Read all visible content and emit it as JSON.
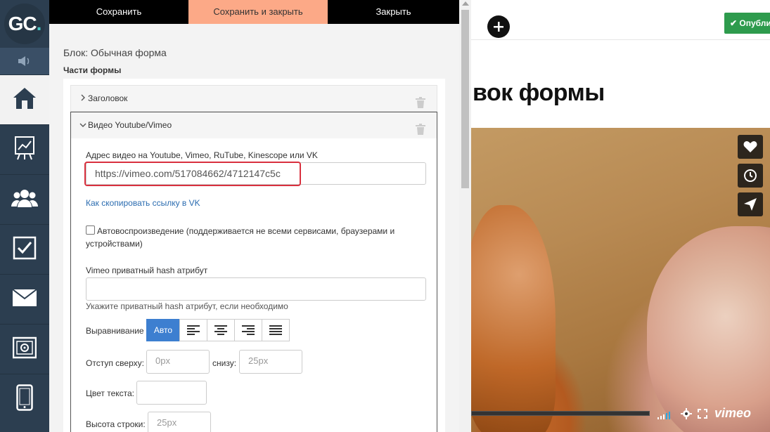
{
  "sidebar": {
    "logo_text": "GC",
    "logo_dot": ".",
    "items": [
      {
        "name": "home-icon",
        "active": true
      },
      {
        "name": "chart-icon",
        "active": false
      },
      {
        "name": "users-icon",
        "active": false
      },
      {
        "name": "checkbox-icon",
        "active": false
      },
      {
        "name": "mail-icon",
        "active": false
      },
      {
        "name": "safe-icon",
        "active": false
      },
      {
        "name": "phone-icon",
        "active": false
      }
    ]
  },
  "toolbar": {
    "save_label": "Сохранить",
    "save_close_label": "Сохранить и закрыть",
    "close_label": "Закрыть"
  },
  "editor": {
    "block_title": "Блок: Обычная форма",
    "parts_title": "Части формы",
    "accordion": {
      "header_label": "Заголовок",
      "video_label": "Видео Youtube/Vimeo"
    },
    "video": {
      "url_label": "Адрес видео на Youtube, Vimeo, RuTube, Kinescope или VK",
      "url_value": "https://vimeo.com/517084662/4712147c5c",
      "vk_link": "Как скопировать ссылку в VK",
      "autoplay_label": "Автовоспроизведение (поддерживается не всеми сервисами, браузерами и устройствами)",
      "hash_label": "Vimeo приватный hash атрибут",
      "hash_value": "",
      "hash_help": "Укажите приватный hash атрибут, если необходимо",
      "align_label": "Выравнивание",
      "align_auto": "Авто",
      "padding_top_label": "Отступ сверху:",
      "padding_top_placeholder": "0px",
      "padding_bottom_label": "снизу:",
      "padding_bottom_placeholder": "25px",
      "text_color_label": "Цвет текста:",
      "line_height_label": "Высота строки:",
      "line_height_placeholder": "25px"
    }
  },
  "preview": {
    "publish_label": "Опубли",
    "heading": "вок формы",
    "video_brand": "vimeo"
  },
  "colors": {
    "sidebar_bg": "#2c3e50",
    "accent_save_close": "#fca987",
    "publish_green": "#2e9b4d",
    "highlight_red": "#d9303e",
    "link_blue": "#2b6cb0",
    "align_active": "#3d7fd0"
  }
}
